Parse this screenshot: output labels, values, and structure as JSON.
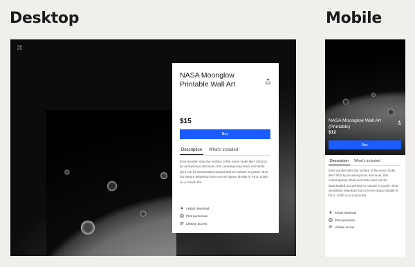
{
  "headings": {
    "desktop": "Desktop",
    "mobile": "Mobile"
  },
  "desktop": {
    "logo": "⌘",
    "product": {
      "title": "NASA Moonglow Printable Wall Art",
      "price": "$15",
      "buy_label": "Buy",
      "tabs": [
        "Description",
        "What's included"
      ],
      "active_tab": "Description",
      "description": "Ever wonder what the surface of the moon looks like? Shot by an anonymous astronaut, this contemporary black and white print can be downloaded and printed on canvas or poster. Shot via 6000m telephoto from a NASA space shuttle in F9.0, 1/200 on a Canon R5.",
      "features": [
        "Instant download",
        "Print permission",
        "Lifetime access"
      ]
    }
  },
  "mobile": {
    "product": {
      "title": "NASA Moonglow Wall Art (Printable)",
      "price": "$12",
      "buy_label": "Buy",
      "tabs": [
        "Description",
        "What's included"
      ],
      "active_tab": "Description",
      "description": "Ever wonder what the surface of the moon looks like? Shot by an anonymous astronaut, this contemporary black and white print can be downloaded and printed on canvas or poster. Shot via 6000m telephoto from a NASA space shuttle in F9.0, 1/200 on a Canon R5.",
      "features": [
        "Instant download",
        "Print permission",
        "Lifetime access"
      ]
    }
  },
  "colors": {
    "accent": "#1a5cff",
    "background": "#f0efeb"
  },
  "icons": {
    "share": "share-icon",
    "download": "lightning-icon",
    "print": "printer-icon",
    "access": "infinity-icon"
  }
}
